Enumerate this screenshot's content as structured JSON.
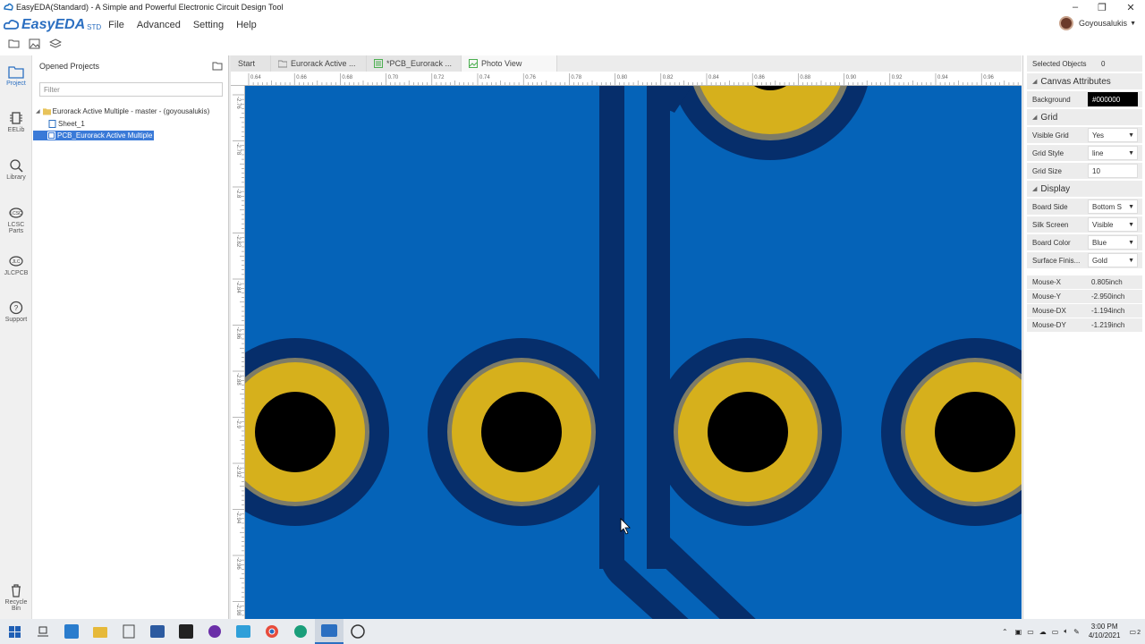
{
  "window": {
    "title": "EasyEDA(Standard) - A Simple and Powerful Electronic Circuit Design Tool"
  },
  "app": {
    "brand": "EasyEDA",
    "edition": "STD"
  },
  "menu": {
    "items": [
      "File",
      "Advanced",
      "Setting",
      "Help"
    ]
  },
  "user": {
    "name": "Goyousalukis"
  },
  "leftnav": {
    "items": [
      {
        "label": "Project",
        "icon": "project-icon"
      },
      {
        "label": "EELib",
        "icon": "eelib-icon"
      },
      {
        "label": "Library",
        "icon": "library-icon"
      },
      {
        "label": "LCSC Parts",
        "icon": "lcsc-icon"
      },
      {
        "label": "JLCPCB",
        "icon": "jlcpcb-icon"
      },
      {
        "label": "Support",
        "icon": "support-icon"
      },
      {
        "label": "Recycle Bin",
        "icon": "recycle-bin-icon"
      }
    ]
  },
  "projects": {
    "header": "Opened Projects",
    "filter_placeholder": "Filter",
    "tree": {
      "root": "Eurorack Active Multiple - master - (goyousalukis)",
      "children": [
        "Sheet_1",
        "PCB_Eurorack Active Multiple"
      ]
    }
  },
  "tabs": [
    {
      "label": "Start",
      "icon": ""
    },
    {
      "label": "Eurorack Active ...",
      "icon": "folder-icon"
    },
    {
      "label": "*PCB_Eurorack ...",
      "icon": "pcb-icon"
    },
    {
      "label": "Photo View",
      "icon": "photo-icon"
    }
  ],
  "ruler": {
    "top_ticks": [
      "0.64",
      "0.66",
      "0.68",
      "0.70",
      "0.72",
      "0.74",
      "0.76",
      "0.78",
      "0.80",
      "0.82",
      "0.84",
      "0.86",
      "0.88",
      "0.90",
      "0.92",
      "0.94",
      "0.96"
    ],
    "left_ticks": [
      "-2.76",
      "-2.78",
      "-2.8",
      "-2.82",
      "-2.84",
      "-2.86",
      "-2.88",
      "-2.9",
      "-2.92",
      "-2.94",
      "-2.96",
      "-2.98"
    ]
  },
  "properties": {
    "selected_label": "Selected Objects",
    "selected_count": "0",
    "canvas_section": "Canvas Attributes",
    "background_label": "Background",
    "background_value": "#000000",
    "grid_section": "Grid",
    "visible_grid_label": "Visible Grid",
    "visible_grid_value": "Yes",
    "grid_style_label": "Grid Style",
    "grid_style_value": "line",
    "grid_size_label": "Grid Size",
    "grid_size_value": "10",
    "display_section": "Display",
    "board_side_label": "Board Side",
    "board_side_value": "Bottom S",
    "silk_screen_label": "Silk Screen",
    "silk_screen_value": "Visible",
    "board_color_label": "Board Color",
    "board_color_value": "Blue",
    "surface_finish_label": "Surface Finis...",
    "surface_finish_value": "Gold",
    "mouse_x_label": "Mouse-X",
    "mouse_x_value": "0.805inch",
    "mouse_y_label": "Mouse-Y",
    "mouse_y_value": "-2.950inch",
    "mouse_dx_label": "Mouse-DX",
    "mouse_dx_value": "-1.194inch",
    "mouse_dy_label": "Mouse-DY",
    "mouse_dy_value": "-1.219inch"
  },
  "colors": {
    "board": "#0563b8",
    "trace": "#062e6b",
    "pad_gold": "#d6b01c",
    "pad_ring": "#7e7c66",
    "hole": "#000000",
    "accent": "#2b6fc1"
  },
  "taskbar": {
    "time": "3:00 PM",
    "date": "4/10/2021",
    "notifications": "2"
  }
}
